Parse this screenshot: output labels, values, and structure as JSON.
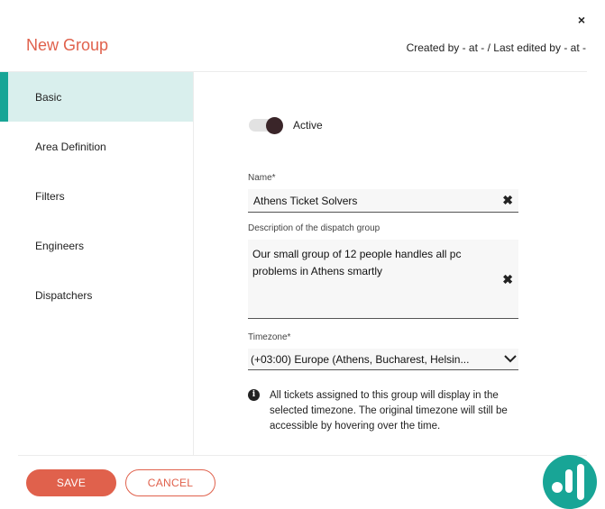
{
  "header": {
    "close_glyph": "×",
    "title": "New Group",
    "meta": "Created by - at - / Last edited by - at -"
  },
  "sidebar": {
    "items": [
      {
        "label": "Basic",
        "active": true
      },
      {
        "label": "Area Definition"
      },
      {
        "label": "Filters"
      },
      {
        "label": "Engineers"
      },
      {
        "label": "Dispatchers"
      }
    ]
  },
  "form": {
    "active_toggle": {
      "label": "Active",
      "on": true
    },
    "name": {
      "label": "Name*",
      "value": "Athens Ticket Solvers"
    },
    "description": {
      "label": "Description of the dispatch group",
      "value": "Our small group of 12 people handles all pc problems in Athens smartly"
    },
    "timezone": {
      "label": "Timezone*",
      "value": "(+03:00) Europe (Athens, Bucharest, Helsin..."
    },
    "clear_glyph": "✖",
    "info": {
      "icon": "info-icon",
      "text": "All tickets assigned to this group will display in the selected timezone. The original timezone will still be accessible by hovering over the time."
    }
  },
  "footer": {
    "save_label": "SAVE",
    "cancel_label": "CANCEL"
  },
  "colors": {
    "accent": "#e0614c",
    "teal": "#18a596",
    "active_bg": "#d9efed"
  }
}
